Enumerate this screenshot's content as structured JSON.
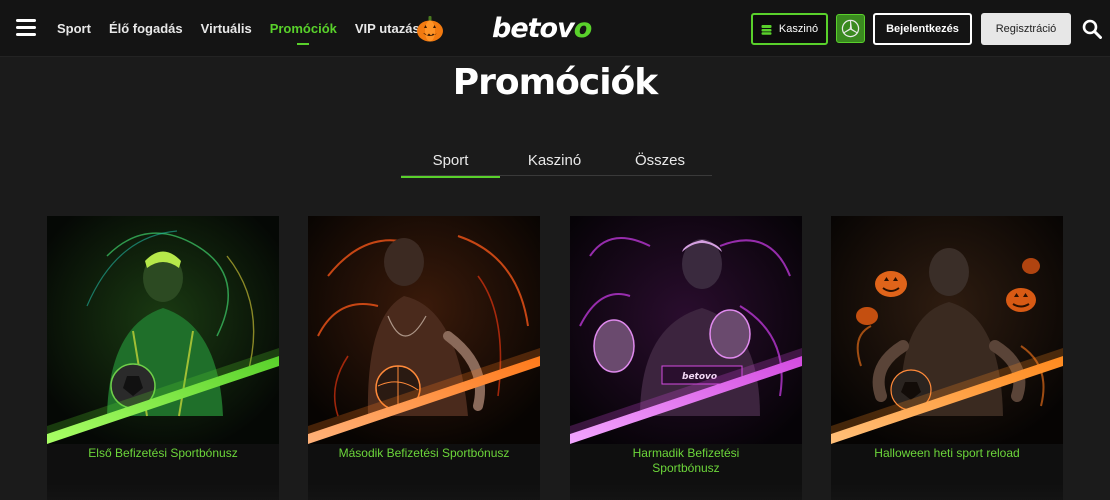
{
  "header": {
    "nav": [
      "Sport",
      "Élő fogadás",
      "Virtuális",
      "Promóciók",
      "VIP utazás"
    ],
    "logo_part1": "betov",
    "logo_part2": "o",
    "casino_label": "Kaszinó",
    "login_label": "Bejelentkezés",
    "register_label": "Regisztráció",
    "icons": [
      "hamburger-icon",
      "pumpkin-icon",
      "casino-chip-icon",
      "mercedes-icon",
      "search-icon"
    ]
  },
  "page": {
    "title": "Promóciók",
    "tabs": [
      "Sport",
      "Kaszinó",
      "Összes"
    ]
  },
  "cards": [
    {
      "caption": "Első Befizetési Sportbónusz",
      "accent": "#59d12b",
      "theme": "footballer"
    },
    {
      "caption": "Második Befizetési Sportbónusz",
      "accent": "#ff7a1a",
      "theme": "basketball"
    },
    {
      "caption": "Harmadik Befizetési Sportbónusz",
      "accent": "#d34be0",
      "theme": "boxer"
    },
    {
      "caption": "Halloween heti sport reload",
      "accent": "#ff8a1e",
      "theme": "halloween"
    }
  ],
  "colors": {
    "brand_green": "#59d12b",
    "bg": "#1b1b1b",
    "header_bg": "#141414"
  }
}
